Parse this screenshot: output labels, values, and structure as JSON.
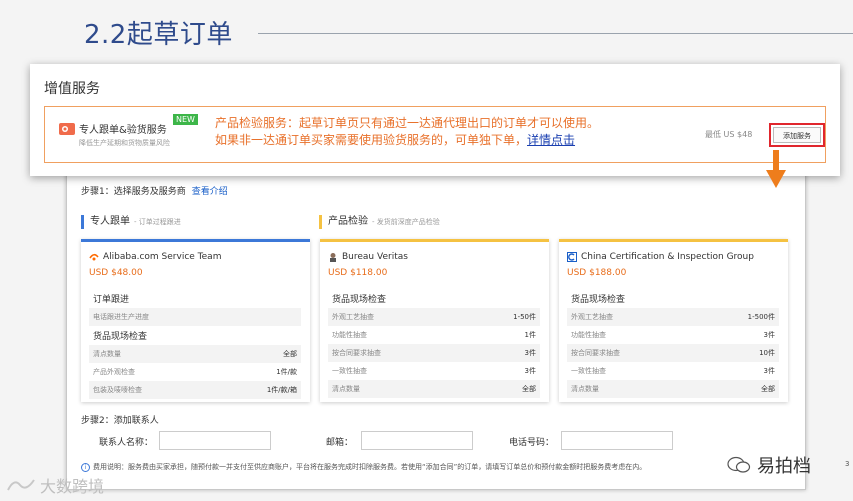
{
  "slide_title": "2.2起草订单",
  "panel": {
    "title": "增值服务",
    "service_name": "专人跟单&验货服务",
    "new_badge": "NEW",
    "service_sub": "降低生产延期和货物质量风险",
    "notice_line1": "产品检验服务：起草订单页只有通过一达通代理出口的订单才可以使用。",
    "notice_line2": "如果非一达通订单买家需要使用验货服务的，可单独下单，",
    "notice_link": "详情点击",
    "min_price": "最低 US $48",
    "add_button": "添加服务"
  },
  "inner": {
    "step1_label": "步骤1：选择服务及服务商",
    "step1_link": "查看介绍",
    "section_track": {
      "title": "专人跟单",
      "sub": "- 订单过程跟进"
    },
    "section_inspect": {
      "title": "产品检验",
      "sub": "- 发货前深度产品检验"
    },
    "cards": [
      {
        "vendor": "Alibaba.com Service Team",
        "price": "USD $48.00",
        "groups": [
          {
            "name": "订单跟进",
            "rows": [
              {
                "label": "电话跟进生产进度",
                "value": ""
              }
            ]
          },
          {
            "name": "货品现场检查",
            "rows": [
              {
                "label": "清点数量",
                "value": "全部"
              },
              {
                "label": "产品外观检查",
                "value": "1件/款"
              },
              {
                "label": "包装及唛嘜检查",
                "value": "1件/款/箱"
              }
            ]
          }
        ]
      },
      {
        "vendor": "Bureau Veritas",
        "price": "USD $118.00",
        "groups": [
          {
            "name": "货品现场检查",
            "rows": [
              {
                "label": "外观工艺抽查",
                "value": "1-50件"
              },
              {
                "label": "功能性抽查",
                "value": "1件"
              },
              {
                "label": "按合同要求抽查",
                "value": "3件"
              },
              {
                "label": "一致性抽查",
                "value": "3件"
              },
              {
                "label": "清点数量",
                "value": "全部"
              }
            ]
          }
        ]
      },
      {
        "vendor": "China Certification & Inspection Group",
        "price": "USD $188.00",
        "groups": [
          {
            "name": "货品现场检查",
            "rows": [
              {
                "label": "外观工艺抽查",
                "value": "1-500件"
              },
              {
                "label": "功能性抽查",
                "value": "3件"
              },
              {
                "label": "按合同要求抽查",
                "value": "10件"
              },
              {
                "label": "一致性抽查",
                "value": "3件"
              },
              {
                "label": "清点数量",
                "value": "全部"
              }
            ]
          }
        ]
      }
    ],
    "step2_label": "步骤2：添加联系人",
    "contact_name_label": "联系人名称：",
    "email_label": "邮箱：",
    "phone_label": "电话号码：",
    "note": "费用说明：服务费由买家承担，随预付款一并支付至供应商账户，平台将在服务完成时扣除服务费。若使用“添加合同”的订单，请填写订单总价和预付款金额时把服务费考虑在内。"
  },
  "watermark_left": "大数跨境",
  "watermark_right": "易拍档",
  "page_number": "3",
  "colors": {
    "accent_orange": "#e8702a",
    "title_blue": "#2f4b8c",
    "blue": "#3c78d8",
    "yellow": "#f5c242",
    "red": "#e0262d"
  }
}
